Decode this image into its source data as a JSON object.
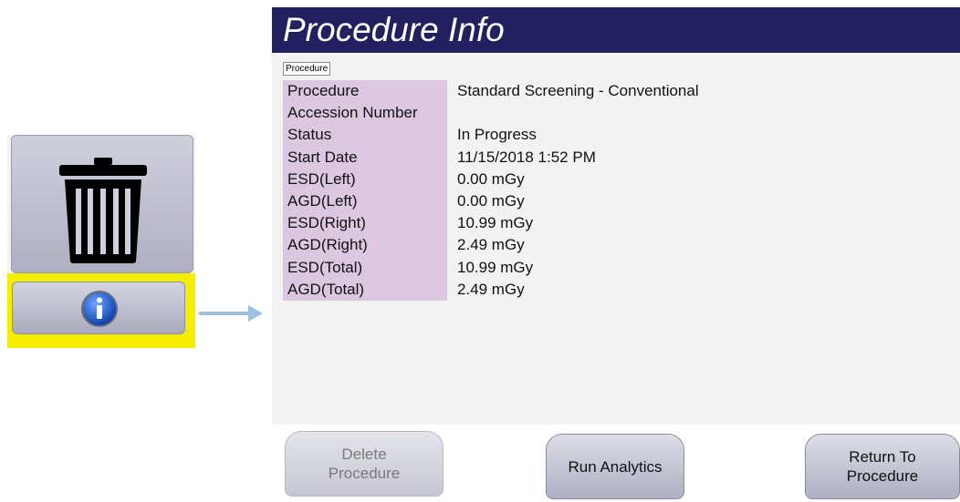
{
  "dialog": {
    "title": "Procedure Info",
    "tab_label": "Procedure",
    "rows": [
      {
        "label": "Procedure",
        "value": "Standard Screening - Conventional"
      },
      {
        "label": "Accession Number",
        "value": ""
      },
      {
        "label": "Status",
        "value": "In Progress"
      },
      {
        "label": "Start Date",
        "value": "11/15/2018 1:52 PM"
      },
      {
        "label": "ESD(Left)",
        "value": "0.00 mGy"
      },
      {
        "label": "AGD(Left)",
        "value": "0.00 mGy"
      },
      {
        "label": "ESD(Right)",
        "value": "10.99 mGy"
      },
      {
        "label": "AGD(Right)",
        "value": "2.49 mGy"
      },
      {
        "label": "ESD(Total)",
        "value": "10.99 mGy"
      },
      {
        "label": "AGD(Total)",
        "value": "2.49 mGy"
      }
    ],
    "buttons": {
      "delete": {
        "label": "Delete\nProcedure",
        "enabled": false
      },
      "run_analytics": {
        "label": "Run Analytics",
        "enabled": true
      },
      "return_to_procedure": {
        "label": "Return To\nProcedure",
        "enabled": true
      }
    }
  },
  "left_panel": {
    "trash_icon": "trash-icon",
    "info_icon": "info-icon",
    "highlight_color": "#f6ee00"
  },
  "colors": {
    "title_bar": "#22205f",
    "label_cell": "#dcc7e0",
    "arrow": "#9fbfdf"
  }
}
